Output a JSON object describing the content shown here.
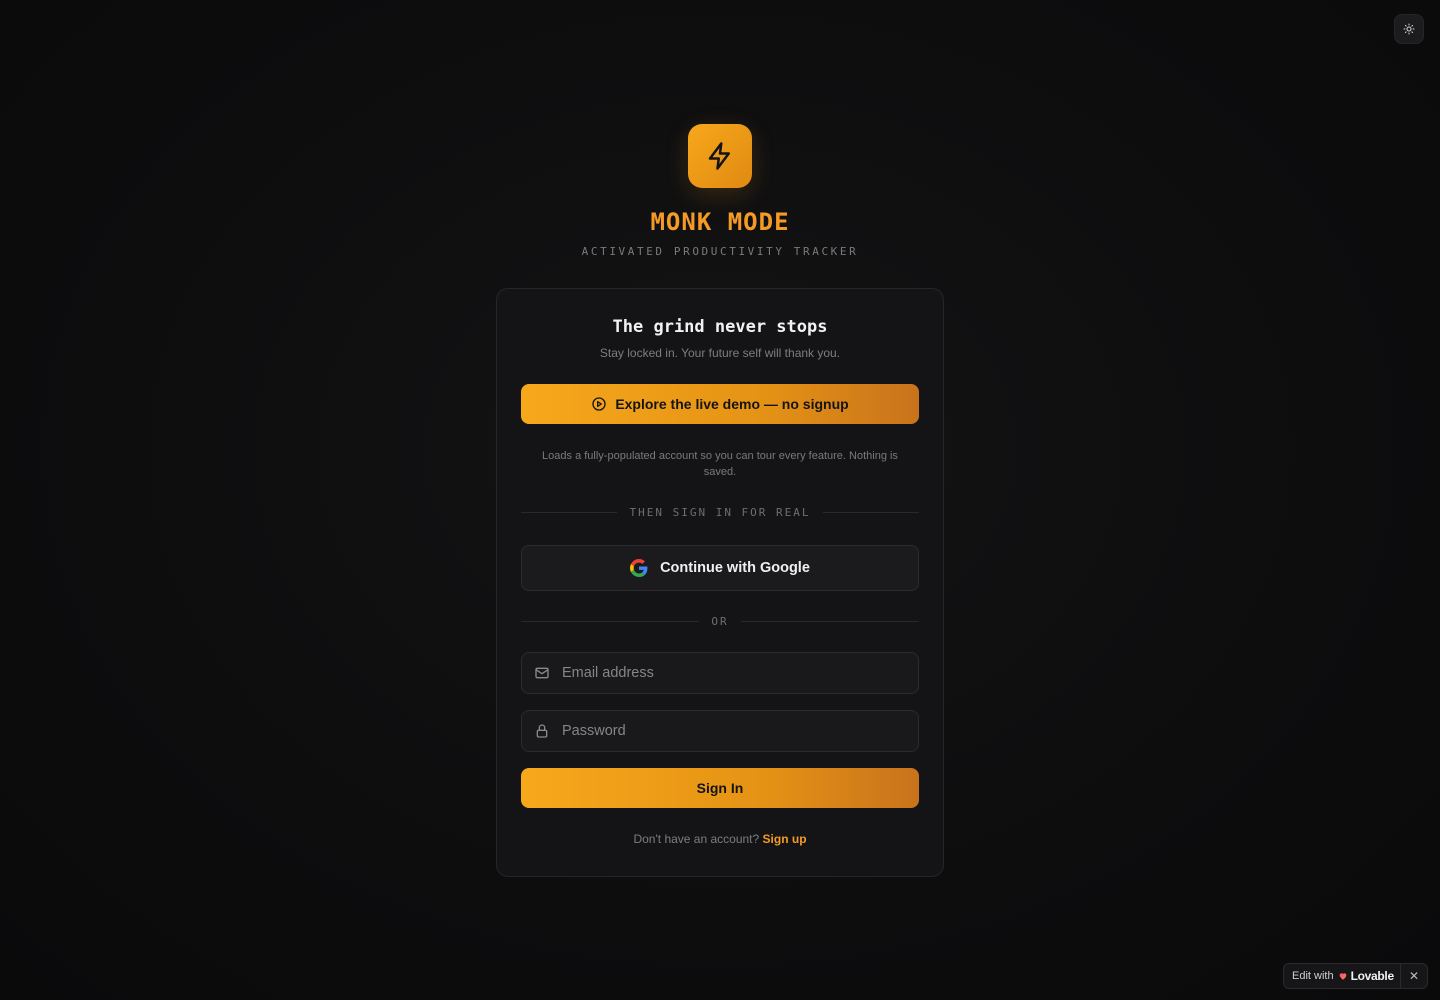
{
  "app": {
    "name": "MONK MODE",
    "tagline": "ACTIVATED PRODUCTIVITY TRACKER"
  },
  "card": {
    "title": "The grind never stops",
    "subtitle": "Stay locked in. Your future self will thank you.",
    "demo_button_label": "Explore the live demo — no signup",
    "demo_note": "Loads a fully-populated account so you can tour every feature. Nothing is saved.",
    "divider_primary": "THEN SIGN IN FOR REAL",
    "google_button_label": "Continue with Google",
    "divider_or": "OR",
    "email": {
      "placeholder": "Email address",
      "value": ""
    },
    "password": {
      "placeholder": "Password",
      "value": ""
    },
    "signin_button_label": "Sign In",
    "signup_prompt": "Don't have an account?",
    "signup_link": "Sign up"
  },
  "badge": {
    "prefix": "Edit with",
    "brand": "Lovable",
    "close": "✕"
  },
  "colors": {
    "accent": "#f59b25",
    "background": "#0d0d0e",
    "card": "#141416"
  },
  "icons": {
    "theme_toggle": "sun-icon",
    "logo": "lightning-bolt-icon",
    "demo": "play-circle-icon",
    "google": "google-g-icon",
    "email": "mail-icon",
    "password": "lock-icon",
    "badge": "lovable-heart-icon",
    "close": "close-icon"
  }
}
